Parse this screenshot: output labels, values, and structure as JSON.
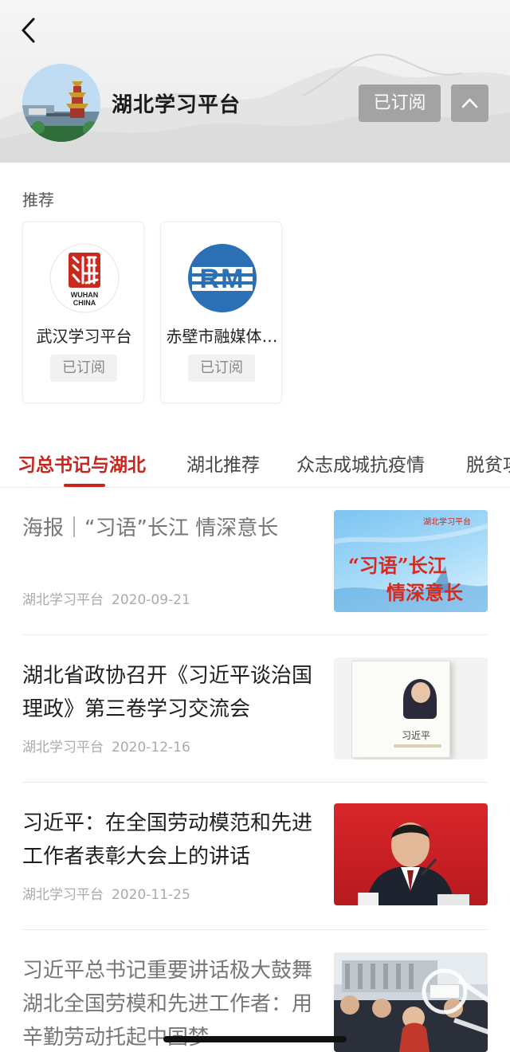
{
  "header": {
    "title": "湖北学习平台",
    "subscribe_label": "已订阅"
  },
  "recommend": {
    "label": "推荐",
    "items": [
      {
        "name": "武汉学习平台",
        "status": "已订阅",
        "logo_text": "WUHAN CHINA"
      },
      {
        "name": "赤壁市融媒体…",
        "status": "已订阅",
        "logo_text": "RM"
      }
    ]
  },
  "tabs": [
    "习总书记与湖北",
    "湖北推荐",
    "众志成城抗疫情",
    "脱贫攻"
  ],
  "articles": [
    {
      "title": "海报｜“习语”长江  情深意长",
      "source": "湖北学习平台",
      "date": "2020-09-21",
      "thumb_text_1": "“习语”长江",
      "thumb_text_2": "情深意长",
      "thumb_badge": "湖北学习平台"
    },
    {
      "title": "湖北省政协召开《习近平谈治国理政》第三卷学习交流会",
      "source": "湖北学习平台",
      "date": "2020-12-16",
      "book_title": "习近平"
    },
    {
      "title": "习近平：在全国劳动模范和先进工作者表彰大会上的讲话",
      "source": "湖北学习平台",
      "date": "2020-11-25"
    },
    {
      "title": "习近平总书记重要讲话极大鼓舞湖北全国劳模和先进工作者：用辛勤劳动托起中国梦"
    }
  ],
  "colors": {
    "accent": "#c8251e",
    "button_gray": "#a3a3a3"
  }
}
